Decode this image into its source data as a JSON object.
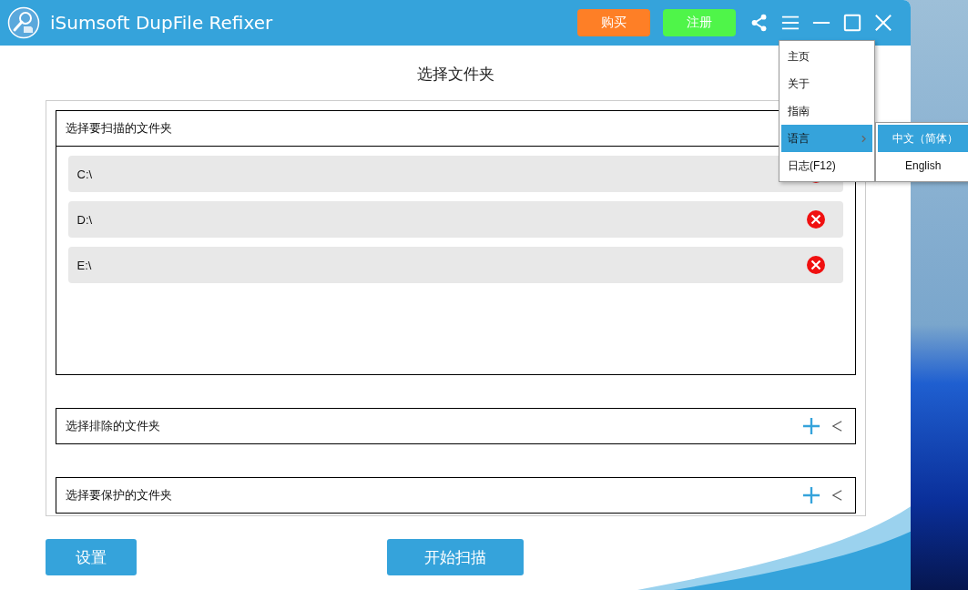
{
  "window": {
    "title": "iSumsoft DupFile Refixer"
  },
  "title_bar": {
    "buy_button": "购买",
    "register_button": "注册"
  },
  "page_title": "选择文件夹",
  "sections": [
    {
      "title": "选择要扫描的文件夹",
      "expanded": true,
      "folders": [
        "C:\\",
        "D:\\",
        "E:\\"
      ]
    },
    {
      "title": "选择排除的文件夹",
      "expanded": false
    },
    {
      "title": "选择要保护的文件夹",
      "expanded": false
    }
  ],
  "buttons": {
    "settings": "设置",
    "start_scan": "开始扫描"
  },
  "menu": {
    "items": [
      {
        "label": "主页",
        "selected": false,
        "has_submenu": false
      },
      {
        "label": "关于",
        "selected": false,
        "has_submenu": false
      },
      {
        "label": "指南",
        "selected": false,
        "has_submenu": false
      },
      {
        "label": "语言",
        "selected": true,
        "has_submenu": true
      },
      {
        "label": "日志(F12)",
        "selected": false,
        "has_submenu": false
      }
    ],
    "submenu": [
      {
        "label": "中文（简体）",
        "selected": true
      },
      {
        "label": "English",
        "selected": false
      }
    ]
  }
}
